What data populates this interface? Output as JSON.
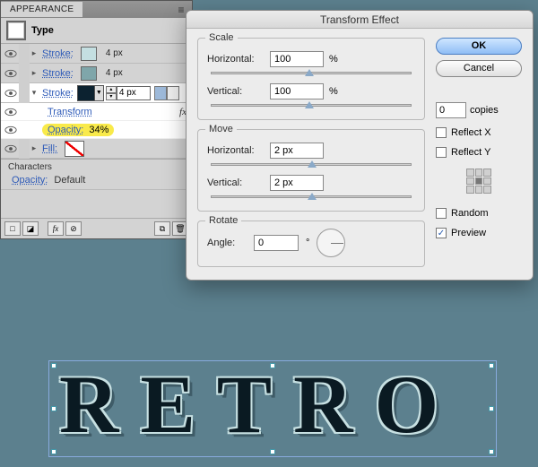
{
  "appearance": {
    "tab": "APPEARANCE",
    "type_label": "Type",
    "strokes": [
      {
        "label": "Stroke:",
        "weight": "4 px"
      },
      {
        "label": "Stroke:",
        "weight": "4 px"
      },
      {
        "label": "Stroke:",
        "weight": "4 px"
      }
    ],
    "transform_label": "Transform",
    "opacity_label": "Opacity:",
    "opacity_value": "34%",
    "fill_label": "Fill:",
    "characters_heading": "Characters",
    "opacity2_label": "Opacity:",
    "opacity2_value": "Default",
    "footer_fx": "fx"
  },
  "dialog": {
    "title": "Transform Effect",
    "scale": {
      "legend": "Scale",
      "h_label": "Horizontal:",
      "h_value": "100",
      "v_label": "Vertical:",
      "v_value": "100",
      "unit": "%"
    },
    "move": {
      "legend": "Move",
      "h_label": "Horizontal:",
      "h_value": "2 px",
      "v_label": "Vertical:",
      "v_value": "2 px"
    },
    "rotate": {
      "legend": "Rotate",
      "angle_label": "Angle:",
      "angle_value": "0",
      "unit": "°"
    },
    "ok": "OK",
    "cancel": "Cancel",
    "copies_value": "0",
    "copies_label": "copies",
    "reflect_x": "Reflect X",
    "reflect_y": "Reflect Y",
    "random": "Random",
    "preview": "Preview"
  },
  "artwork": {
    "text": "RETRO"
  }
}
